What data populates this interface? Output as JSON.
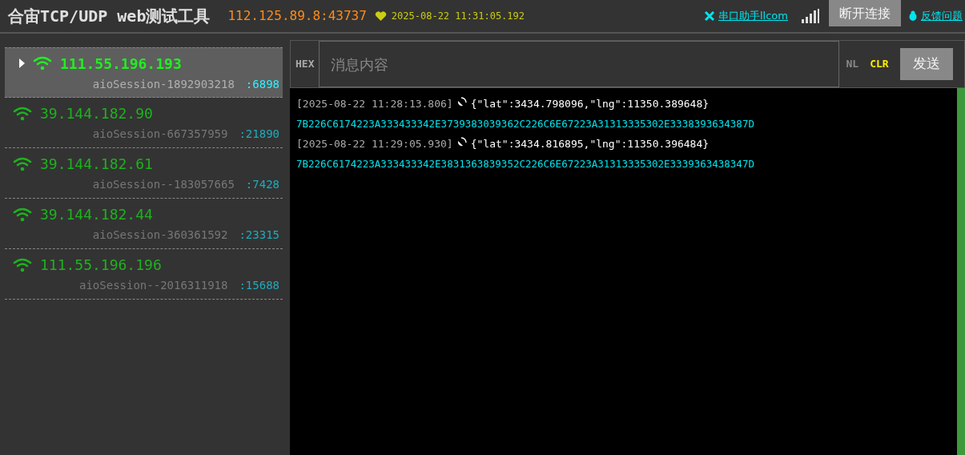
{
  "header": {
    "title": "合宙TCP/UDP web测试工具",
    "address": "112.125.89.8:43737",
    "timestamp": "2025-08-22 11:31:05.192",
    "tool_link": "串口助手llcom",
    "disconnect_button": "断开连接",
    "feedback_link": "反馈问题"
  },
  "sessions": [
    {
      "ip": "111.55.196.193",
      "session": "aioSession-1892903218",
      "port": ":6898",
      "selected": true
    },
    {
      "ip": "39.144.182.90",
      "session": "aioSession-667357959",
      "port": ":21890",
      "selected": false
    },
    {
      "ip": "39.144.182.61",
      "session": "aioSession--183057665",
      "port": ":7428",
      "selected": false
    },
    {
      "ip": "39.144.182.44",
      "session": "aioSession-360361592",
      "port": ":23315",
      "selected": false
    },
    {
      "ip": "111.55.196.196",
      "session": "aioSession--2016311918",
      "port": ":15688",
      "selected": false
    }
  ],
  "composer": {
    "hex_toggle": "HEX",
    "placeholder": "消息内容",
    "nl_toggle": "NL",
    "clear_button": "CLR",
    "send_button": "发送"
  },
  "log": [
    {
      "time": "[2025-08-22 11:28:13.806]",
      "message": "{\"lat\":3434.798096,\"lng\":11350.389648}",
      "hex": "7B226C6174223A333433342E3739383039362C226C6E67223A31313335302E3338393634387D"
    },
    {
      "time": "[2025-08-22 11:29:05.930]",
      "message": "{\"lat\":3434.816895,\"lng\":11350.396484}",
      "hex": "7B226C6174223A333433342E3831363839352C226C6E67223A31313335302E3339363438347D"
    }
  ]
}
